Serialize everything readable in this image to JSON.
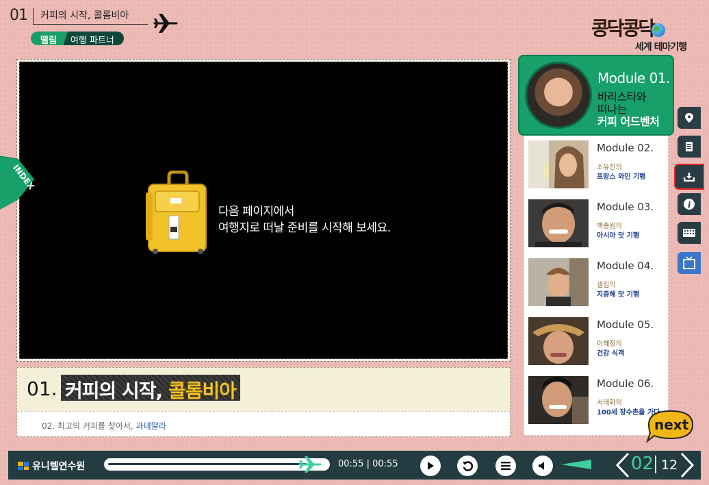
{
  "header": {
    "course_number": "01",
    "course_title": "커피의 시작, 콜롬비아",
    "tag_primary": "떨림",
    "tag_secondary": "여행 파트너"
  },
  "logo": {
    "main": "콩닥콩닥",
    "sub": "세계 테마기행"
  },
  "video": {
    "message_line1": "다음 페이지에서",
    "message_line2": "여행지로 떠날 준비를 시작해 보세요.",
    "index_tab_label": "INDEX"
  },
  "title_panel": {
    "number": "01.",
    "title_plain": "커피의 시작, ",
    "title_highlight": "콜롬비아",
    "next_prefix": "02. 최고의 커피를 찾아서, ",
    "next_highlight": "과테말라"
  },
  "modules": {
    "active": {
      "label": "Module 01.",
      "line1": "바리스타와",
      "line2": "떠나는",
      "line3": "커피 어드벤처"
    },
    "items": [
      {
        "label": "Module 02.",
        "person": "소유진의",
        "theme": "프랑스 와인 기행"
      },
      {
        "label": "Module 03.",
        "person": "백종원의",
        "theme": "아시아 맛 기행"
      },
      {
        "label": "Module 04.",
        "person": "샘킴의",
        "theme": "지중해 맛 기행"
      },
      {
        "label": "Module 05.",
        "person": "이혜정의",
        "theme": "건강 식객"
      },
      {
        "label": "Module 06.",
        "person": "서태화의",
        "theme": "100세 장수촌을 가다"
      }
    ]
  },
  "sidebar": {
    "icons": [
      "map-pin-icon",
      "document-icon",
      "download-icon",
      "info-icon",
      "keyboard-icon",
      "tv-icon"
    ],
    "selected": "download-icon"
  },
  "next_button": {
    "label": "next"
  },
  "bottom_bar": {
    "org_name": "유니텔연수원",
    "time_current": "00:55",
    "time_total": "00:55",
    "progress": 1.0,
    "page_current": "02",
    "page_total": "12"
  },
  "colors": {
    "background": "#ecb8b3",
    "accent_green": "#17a06a",
    "dark_bar": "#233c42",
    "highlight_yellow": "#f6c21a",
    "mint": "#3fcf9e"
  }
}
